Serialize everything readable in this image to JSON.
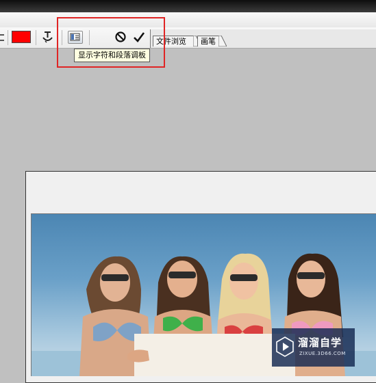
{
  "colors": {
    "text_color_swatch": "#ff0000",
    "highlight": "#e02424",
    "tooltip_bg": "#ffffe1"
  },
  "toolbar": {
    "icons": [
      "text-color-swatch",
      "warp-text-icon",
      "character-paragraph-palette-icon",
      "cancel-icon",
      "commit-check-icon"
    ]
  },
  "tooltip": {
    "text": "显示字符和段落调板"
  },
  "palette_well": {
    "tabs": [
      {
        "label": "文件浏览"
      },
      {
        "label": "画笔"
      }
    ]
  },
  "watermark": {
    "title": "溜溜自学",
    "subtitle": "ZIXUE.3D66.COM"
  }
}
